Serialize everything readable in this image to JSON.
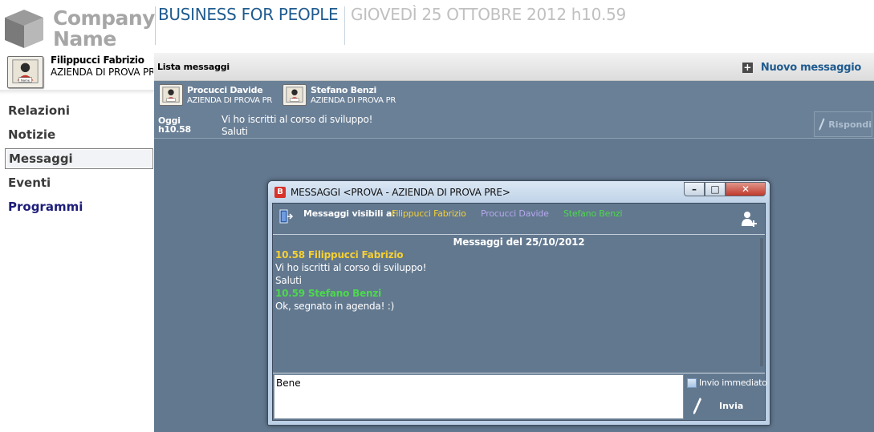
{
  "header": {
    "logo_line1": "Company",
    "logo_line2": "Name",
    "app_title": "BUSINESS FOR PEOPLE",
    "datetime": "GIOVEDÌ 25 OTTOBRE 2012 h10.59"
  },
  "user": {
    "name": "Filippucci Fabrizio",
    "company": "AZIENDA DI PROVA PR",
    "avatar_caption": "Name"
  },
  "nav": {
    "items": [
      {
        "label": "Relazioni"
      },
      {
        "label": "Notizie"
      },
      {
        "label": "Messaggi",
        "selected": true
      },
      {
        "label": "Eventi"
      },
      {
        "label": "Programmi"
      }
    ]
  },
  "list": {
    "title": "Lista messaggi",
    "new_message_label": "Nuovo messaggio",
    "new_message_icon": "plus-icon"
  },
  "thread": {
    "participants": [
      {
        "name": "Procucci Davide",
        "company": "AZIENDA DI PROVA PR"
      },
      {
        "name": "Stefano Benzi",
        "company": "AZIENDA DI PROVA PR"
      }
    ],
    "day": "Oggi",
    "time": "h10.58",
    "lines": [
      "Vi ho iscritti al corso di sviluppo!",
      "Saluti"
    ],
    "reply_label": "Rispondi"
  },
  "dialog": {
    "title": "MESSAGGI <PROVA - AZIENDA DI PROVA PRE>",
    "app_icon_letter": "B",
    "buttons": {
      "minimize": "–",
      "maximize": "□",
      "close": "✕"
    },
    "visible_label": "Messaggi visibili a:",
    "visible_to": [
      {
        "name": "Filippucci Fabrizio",
        "color": "#f5d033"
      },
      {
        "name": "Procucci Davide",
        "color": "#b6a8ef"
      },
      {
        "name": "Stefano Benzi",
        "color": "#4bd94b"
      }
    ],
    "transcript_header": "Messaggi del 25/10/2012",
    "messages": [
      {
        "header": "10.58 Filippucci Fabrizio",
        "color": "#f5d033",
        "lines": [
          "Vi ho iscritti al corso di sviluppo!",
          "Saluti"
        ]
      },
      {
        "header": "10.59 Stefano Benzi",
        "color": "#4bd94b",
        "lines": [
          "Ok, segnato in agenda! :)"
        ]
      }
    ],
    "compose_value": "Bene",
    "immediate_label": "Invio immediato",
    "immediate_checked": false,
    "send_label": "Invia"
  },
  "colors": {
    "brand_blue": "#1f5b8f",
    "panel_bg": "#62788f",
    "logo_gray": "#a6a6a6"
  }
}
